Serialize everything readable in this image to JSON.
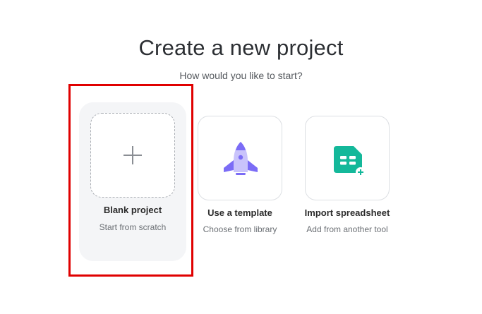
{
  "header": {
    "title": "Create a new project",
    "subtitle": "How would you like to start?"
  },
  "options": [
    {
      "label": "Blank project",
      "sublabel": "Start from scratch",
      "icon": "plus-icon",
      "selected": true
    },
    {
      "label": "Use a template",
      "sublabel": "Choose from library",
      "icon": "rocket-icon"
    },
    {
      "label": "Import spreadsheet",
      "sublabel": "Add from another tool",
      "icon": "spreadsheet-import-icon"
    }
  ],
  "colors": {
    "highlight": "#e00000",
    "rocket": "#7b6cf6",
    "spreadsheet": "#14b89a"
  }
}
